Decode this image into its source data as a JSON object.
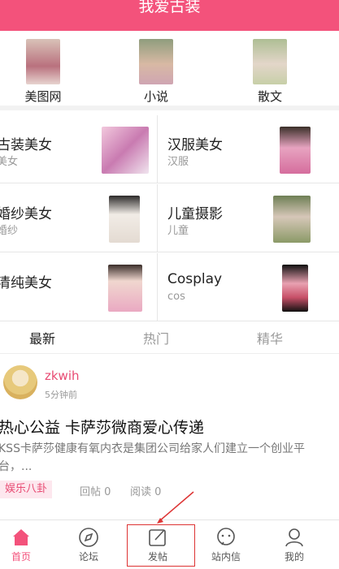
{
  "header": {
    "title": "我爱古装"
  },
  "top_categories": [
    {
      "label": "美图网",
      "thumb_color": "#c9a0a8",
      "icon": "girl-photo-thumb"
    },
    {
      "label": "小说",
      "thumb_color": "#a7b8a2",
      "icon": "girl-photo-thumb"
    },
    {
      "label": "散文",
      "thumb_color": "#b6c4a7",
      "icon": "girl-photo-thumb"
    }
  ],
  "grid": [
    {
      "title": "古装美女",
      "sub": "美女",
      "pic_color": "#e6a7c9"
    },
    {
      "title": "汉服美女",
      "sub": "汉服",
      "pic_color": "#d78ab0"
    },
    {
      "title": "婚纱美女",
      "sub": "婚纱",
      "pic_color": "#e9e0d8"
    },
    {
      "title": "儿童摄影",
      "sub": "儿童",
      "pic_color": "#8a9a6d"
    },
    {
      "title": "清纯美女",
      "sub": "",
      "pic_color": "#e7b7c3"
    },
    {
      "title": "Cosplay",
      "sub": "cos",
      "pic_color": "#d86a7f"
    }
  ],
  "tabs": [
    {
      "label": "最新"
    },
    {
      "label": "热门"
    },
    {
      "label": "精华"
    }
  ],
  "post": {
    "author": "zkwih",
    "time_ago": "5分钟前",
    "title": "热心公益  卡萨莎微商爱心传递",
    "body": "KSS卡萨莎健康有氧内衣是集团公司给家人们建立一个创业平台，...",
    "badge": "娱乐八卦",
    "replies": "回帖 0",
    "reads": "阅读 0"
  },
  "bottom_nav": [
    {
      "label": "首页",
      "icon": "home-icon"
    },
    {
      "label": "论坛",
      "icon": "compass-icon"
    },
    {
      "label": "发帖",
      "icon": "compose-icon"
    },
    {
      "label": "站内信",
      "icon": "chat-bubble-icon"
    },
    {
      "label": "我的",
      "icon": "person-icon"
    }
  ],
  "colors": {
    "accent": "#f3527b",
    "annotation": "#dd3333"
  }
}
